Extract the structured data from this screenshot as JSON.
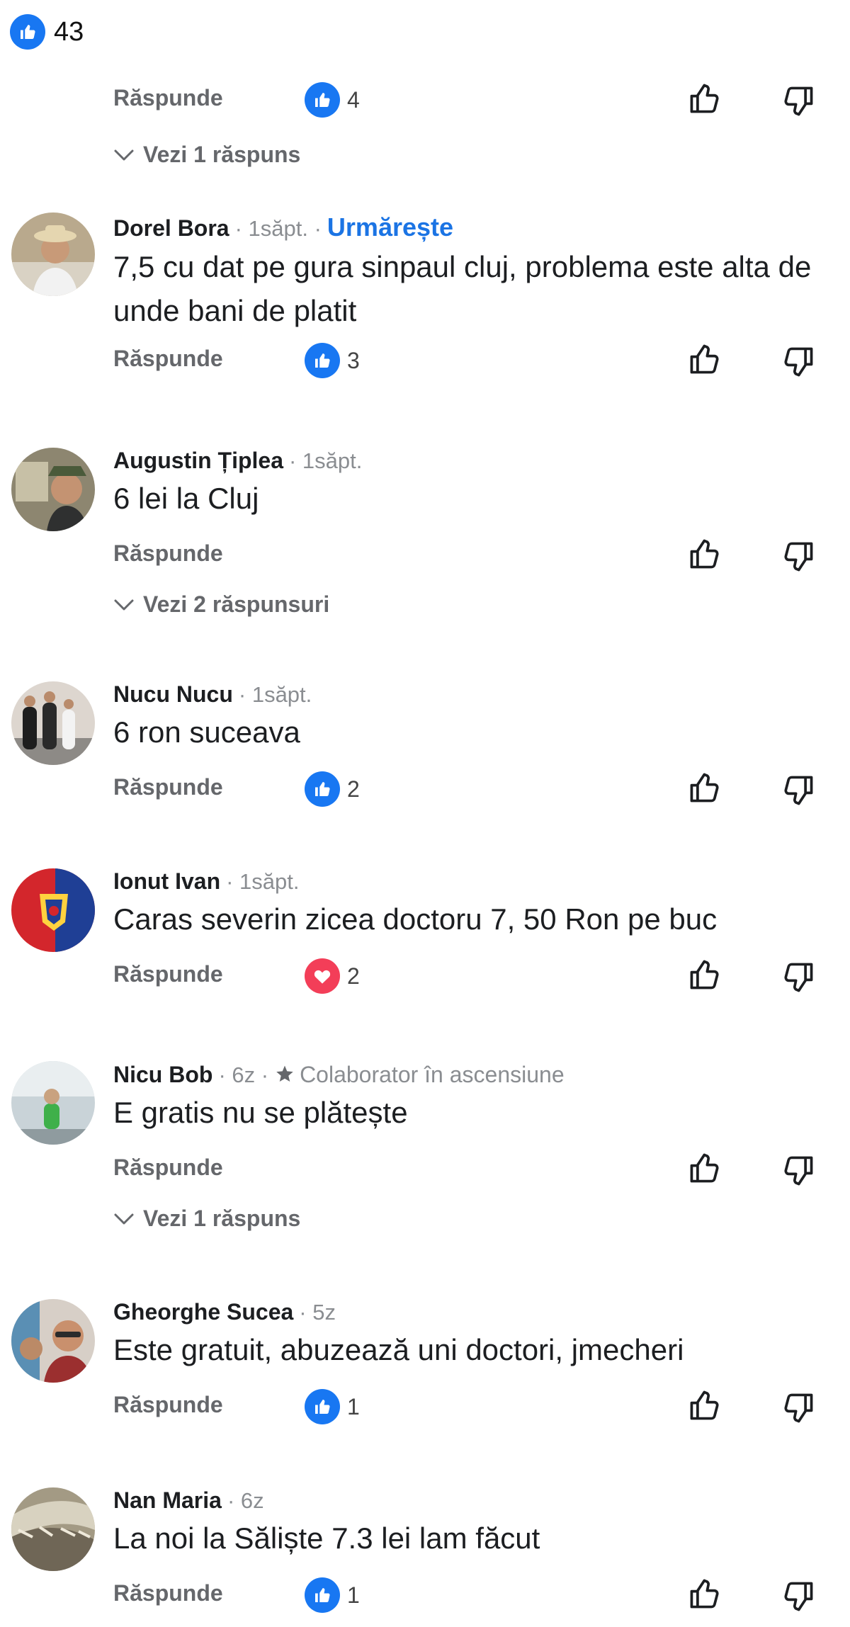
{
  "top": {
    "reaction_count": "43"
  },
  "first_actions": {
    "reply_label": "Răspunde",
    "reaction_count": "4",
    "toggle_label": "Vezi 1 răspuns"
  },
  "comments": [
    {
      "author": "Dorel Bora",
      "time": "· 1săpt. ·",
      "follow": "Urmărește",
      "text": "7,5 cu dat pe gura sinpaul cluj, problema este alta de unde bani de platit",
      "reply": "Răspunde",
      "reaction_count": "3",
      "reaction_type": "like"
    },
    {
      "author": "Augustin Țiplea",
      "time": "· 1săpt.",
      "text": "6 lei la Cluj",
      "reply": "Răspunde",
      "toggle": "Vezi 2 răspunsuri"
    },
    {
      "author": "Nucu Nucu",
      "time": "· 1săpt.",
      "text": "6 ron suceava",
      "reply": "Răspunde",
      "reaction_count": "2",
      "reaction_type": "like"
    },
    {
      "author": "Ionut Ivan",
      "time": "· 1săpt.",
      "text": "Caras severin zicea doctoru 7, 50 Ron pe buc",
      "reply": "Răspunde",
      "reaction_count": "2",
      "reaction_type": "love"
    },
    {
      "author": "Nicu Bob",
      "time": "· 6z ·",
      "badge": "Colaborator în ascensiune",
      "text": "E gratis nu se plătește",
      "reply": "Răspunde",
      "toggle": "Vezi 1 răspuns"
    },
    {
      "author": "Gheorghe Sucea",
      "time": "· 5z",
      "text": "Este gratuit, abuzează uni doctori, jmecheri",
      "reply": "Răspunde",
      "reaction_count": "1",
      "reaction_type": "like"
    },
    {
      "author": "Nan Maria",
      "time": "· 6z",
      "text": "La noi  la Săliște 7.3 lei lam făcut",
      "reply": "Răspunde",
      "reaction_count": "1",
      "reaction_type": "like"
    }
  ],
  "colors": {
    "link_blue": "#1b74e4",
    "like_blue": "#1877f2",
    "love_red": "#f33e58",
    "secondary_text": "#65676b"
  }
}
